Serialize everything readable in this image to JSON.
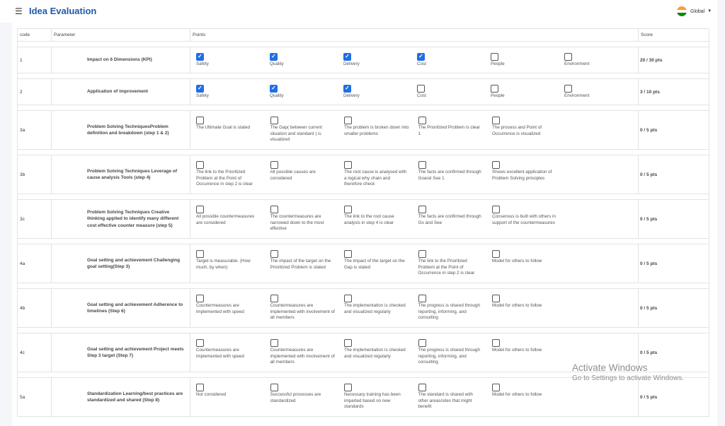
{
  "header": {
    "title": "Idea Evaluation",
    "region": "Global"
  },
  "table": {
    "columns": {
      "code": "code",
      "parameter": "Parameter",
      "points": "Points",
      "score": "Score"
    },
    "rows": [
      {
        "code": "1",
        "parameter": "Impact on 6 Dimensions (KPI)",
        "score": "20 / 30  pts",
        "options": [
          {
            "label": "Safety",
            "checked": true
          },
          {
            "label": "Quality",
            "checked": true
          },
          {
            "label": "Delivery",
            "checked": true
          },
          {
            "label": "Cost",
            "checked": true
          },
          {
            "label": "People",
            "checked": false
          },
          {
            "label": "Environment",
            "checked": false
          }
        ]
      },
      {
        "code": "2",
        "parameter": "Application of improvement",
        "score": "3 / 10  pts",
        "options": [
          {
            "label": "Safety",
            "checked": true
          },
          {
            "label": "Quality",
            "checked": true
          },
          {
            "label": "Delivery",
            "checked": true
          },
          {
            "label": "Cost",
            "checked": false
          },
          {
            "label": "People",
            "checked": false
          },
          {
            "label": "Environment",
            "checked": false
          }
        ]
      },
      {
        "code": "3a",
        "parameter": "Problem Solving TechniquesProblem definition and breakdown (step 1 & 2)",
        "score": "0 / 5  pts",
        "options": [
          {
            "label": "The Ultimate Goal is stated",
            "checked": false
          },
          {
            "label": "The Gap( between current situation and standard ) is visualized",
            "checked": false
          },
          {
            "label": "The problem is broken down into smaller problems",
            "checked": false
          },
          {
            "label": "The Prioritized Problem is clear 1",
            "checked": false
          },
          {
            "label": "The process and Point of Occurrence is visualized",
            "checked": false
          }
        ]
      },
      {
        "code": "3b",
        "parameter": "Problem Solving Techniques Leverage of cause analysis Tools (step 4)",
        "score": "0 / 5  pts",
        "options": [
          {
            "label": "The link to the Prioritized Problem at the Point of Occurrence in step 2 is clear",
            "checked": false
          },
          {
            "label": "All possible causes are considered",
            "checked": false
          },
          {
            "label": "The root cause is analysed with a logical why chain and therefore check",
            "checked": false
          },
          {
            "label": "The facts are confirmed through Goand See 1",
            "checked": false
          },
          {
            "label": "Shows excellent application of Problem Solving principles",
            "checked": false
          }
        ]
      },
      {
        "code": "3c",
        "parameter": "Problem Solving Techniques Creative thinking applied to identify many different cost effective counter measure (step 5)",
        "score": "0 / 5  pts",
        "options": [
          {
            "label": "All possible countermeasures are considered",
            "checked": false
          },
          {
            "label": "The countermeasures are narrowed down to the most effective",
            "checked": false
          },
          {
            "label": "The link to the root cause analysis in step 4 is clear",
            "checked": false
          },
          {
            "label": "The facts are confirmed through Go and See",
            "checked": false
          },
          {
            "label": "Consensus is built with others in support of the countermeasures",
            "checked": false
          }
        ]
      },
      {
        "code": "4a",
        "parameter": "Goal setting and achievement Challenging goal setting(Step 3)",
        "score": "0 / 5  pts",
        "options": [
          {
            "label": "Target is measurable. (How much, by when)",
            "checked": false
          },
          {
            "label": "The impact of the target on the Prioritized Problem is stated",
            "checked": false
          },
          {
            "label": "The impact of the target on the Gap is stated",
            "checked": false
          },
          {
            "label": "The link to the Prioritized Problem at the Point of Occurrence in step 2 is clear",
            "checked": false
          },
          {
            "label": "Model for others to follow",
            "checked": false
          }
        ]
      },
      {
        "code": "4b",
        "parameter": "Goal setting and achievement Adherence to timelines (Step 6)",
        "score": "0 / 5  pts",
        "options": [
          {
            "label": "Countermeasures are implemented with speed",
            "checked": false
          },
          {
            "label": "Countermeasures are implemented with involvement of all members",
            "checked": false
          },
          {
            "label": "The implementation is checked and visualized regularly",
            "checked": false
          },
          {
            "label": "The progress is shared through reporting, informing, and consulting",
            "checked": false
          },
          {
            "label": "Model for others to follow",
            "checked": false
          }
        ]
      },
      {
        "code": "4c",
        "parameter": "Goal setting and achievement Project meets Step 3 target (Step 7)",
        "score": "0 / 5  pts",
        "options": [
          {
            "label": "Countermeasures are implemented with speed",
            "checked": false
          },
          {
            "label": "Countermeasures are implemented with involvement of all members",
            "checked": false
          },
          {
            "label": "The implementation is checked and visualized regularly",
            "checked": false
          },
          {
            "label": "The progress is shared through reporting, informing, and consulting",
            "checked": false
          },
          {
            "label": "Model for others to follow",
            "checked": false
          }
        ]
      },
      {
        "code": "5a",
        "parameter": "Standardization Learning/best practices are standardized and shared (Step 8)",
        "score": "0 / 5  pts",
        "options": [
          {
            "label": "Not considered",
            "checked": false
          },
          {
            "label": "Successful processes are standardized",
            "checked": false
          },
          {
            "label": "Necessary training has been imparted based on new standards",
            "checked": false
          },
          {
            "label": "The standard is shared with other areas/sites that might benefit",
            "checked": false
          },
          {
            "label": "Model for others to follow",
            "checked": false
          }
        ]
      }
    ]
  },
  "watermark": {
    "title": "Activate Windows",
    "subtitle": "Go to Settings to activate Windows."
  },
  "colors": {
    "accent": "#1f5aa8",
    "checkbox_checked": "#1f6fe5"
  }
}
